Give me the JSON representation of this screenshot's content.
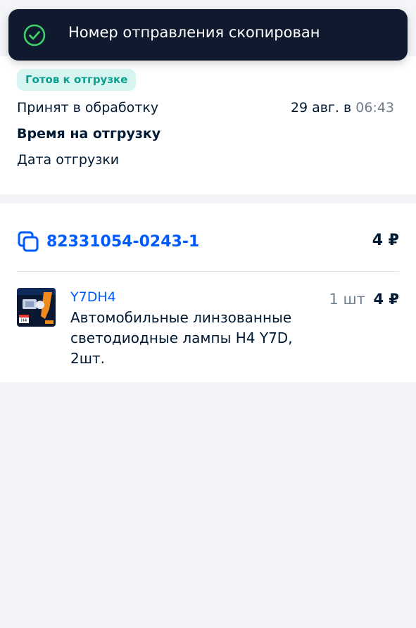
{
  "toast": {
    "icon": "check-circle-icon",
    "message": "Номер отправления скопирован",
    "icon_color": "#3fcf6a"
  },
  "status": {
    "badge": "Готов к отгрузке",
    "rows": [
      {
        "label": "Принят в обработку",
        "date": "29 авг. в",
        "time": "06:43"
      },
      {
        "label": "Время на отгрузку"
      },
      {
        "label": "Дата отгрузки"
      }
    ]
  },
  "shipment": {
    "icon": "copy-icon",
    "number": "82331054-0243-1",
    "price": "4 ₽"
  },
  "item": {
    "sku": "Y7DH4",
    "title": "Автомобильные линзованные светодиодные лампы H4 Y7D, 2шт.",
    "quantity": "1 шт",
    "price": "4 ₽",
    "thumbnail_label": "H4"
  },
  "colors": {
    "accent": "#005bff",
    "badge_bg": "#d6f5f1",
    "badge_text": "#0d9e8f",
    "toast_bg": "#0f1a2e",
    "muted": "#707f8d"
  }
}
